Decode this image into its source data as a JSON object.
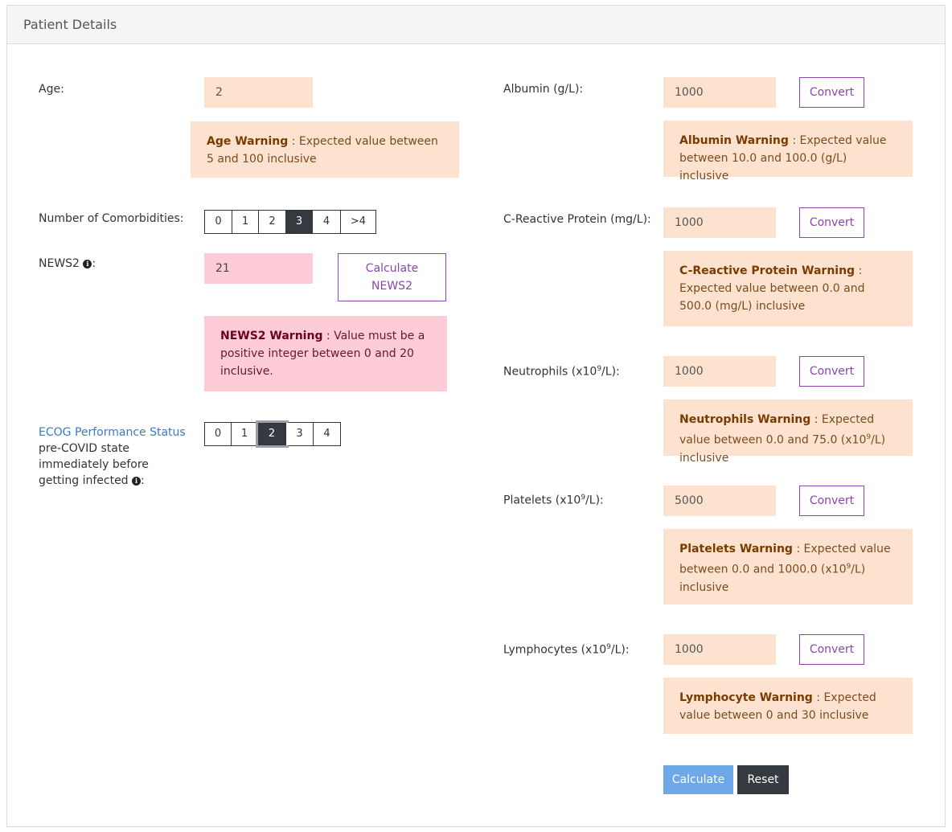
{
  "header": {
    "title": "Patient Details"
  },
  "age": {
    "label": "Age:",
    "value": "2",
    "warning_title": "Age Warning",
    "warning_text": " : Expected value between 5 and 100 inclusive"
  },
  "comorbidities": {
    "label": "Number of Comorbidities:",
    "options": [
      "0",
      "1",
      "2",
      "3",
      "4",
      ">4"
    ],
    "selected": "3"
  },
  "news2": {
    "label": "NEWS2",
    "value": "21",
    "calc_button": "Calculate NEWS2",
    "warning_title": "NEWS2 Warning",
    "warning_text": " : Value must be a positive integer between 0 and 20 inclusive."
  },
  "ecog": {
    "link": "ECOG Performance Status",
    "text": "pre-COVID state immediately before getting infected",
    "options": [
      "0",
      "1",
      "2",
      "3",
      "4"
    ],
    "selected": "2"
  },
  "albumin": {
    "label": "Albumin (g/L):",
    "value": "1000",
    "convert": "Convert",
    "warning_title": "Albumin Warning",
    "warning_text": " : Expected value between 10.0 and 100.0 (g/L) inclusive"
  },
  "crp": {
    "label": "C-Reactive Protein (mg/L):",
    "value": "1000",
    "convert": "Convert",
    "warning_title": "C-Reactive Protein Warning",
    "warning_text": " : Expected value between 0.0 and 500.0 (mg/L) inclusive"
  },
  "neutrophils": {
    "label_pre": "Neutrophils (x10",
    "sup": "9",
    "label_post": "/L):",
    "value": "1000",
    "convert": "Convert",
    "warning_title": "Neutrophils Warning",
    "warning_pre": " : Expected value between 0.0 and 75.0 (x10",
    "warning_post": "/L) inclusive"
  },
  "platelets": {
    "label_pre": "Platelets (x10",
    "sup": "9",
    "label_post": "/L):",
    "value": "5000",
    "convert": "Convert",
    "warning_title": "Platelets Warning",
    "warning_pre": " : Expected value between 0.0 and 1000.0 (x10",
    "warning_post": "/L) inclusive"
  },
  "lymphocytes": {
    "label_pre": "Lymphocytes (x10",
    "sup": "9",
    "label_post": "/L):",
    "value": "1000",
    "convert": "Convert",
    "warning_title": "Lymphocyte Warning",
    "warning_text": " : Expected value between 0 and 30 inclusive"
  },
  "actions": {
    "calculate": "Calculate",
    "reset": "Reset"
  },
  "icons": {
    "info": "info-circle-icon"
  }
}
